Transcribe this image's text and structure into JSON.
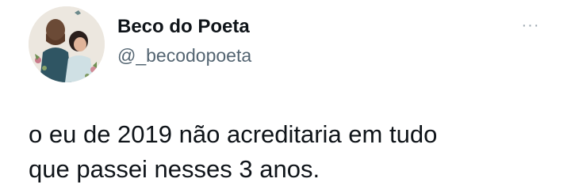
{
  "author": {
    "display_name": "Beco do Poeta",
    "handle": "@_becodopoeta",
    "avatar_icon": "couple-illustration-avatar"
  },
  "menu": {
    "icon": "more-options-icon",
    "glyph": "···"
  },
  "tweet": {
    "line1": "o eu de 2019 não acreditaria em tudo",
    "line2": "que passei nesses 3 anos."
  },
  "colors": {
    "text": "#0f1419",
    "secondary": "#536471",
    "background": "#ffffff"
  }
}
